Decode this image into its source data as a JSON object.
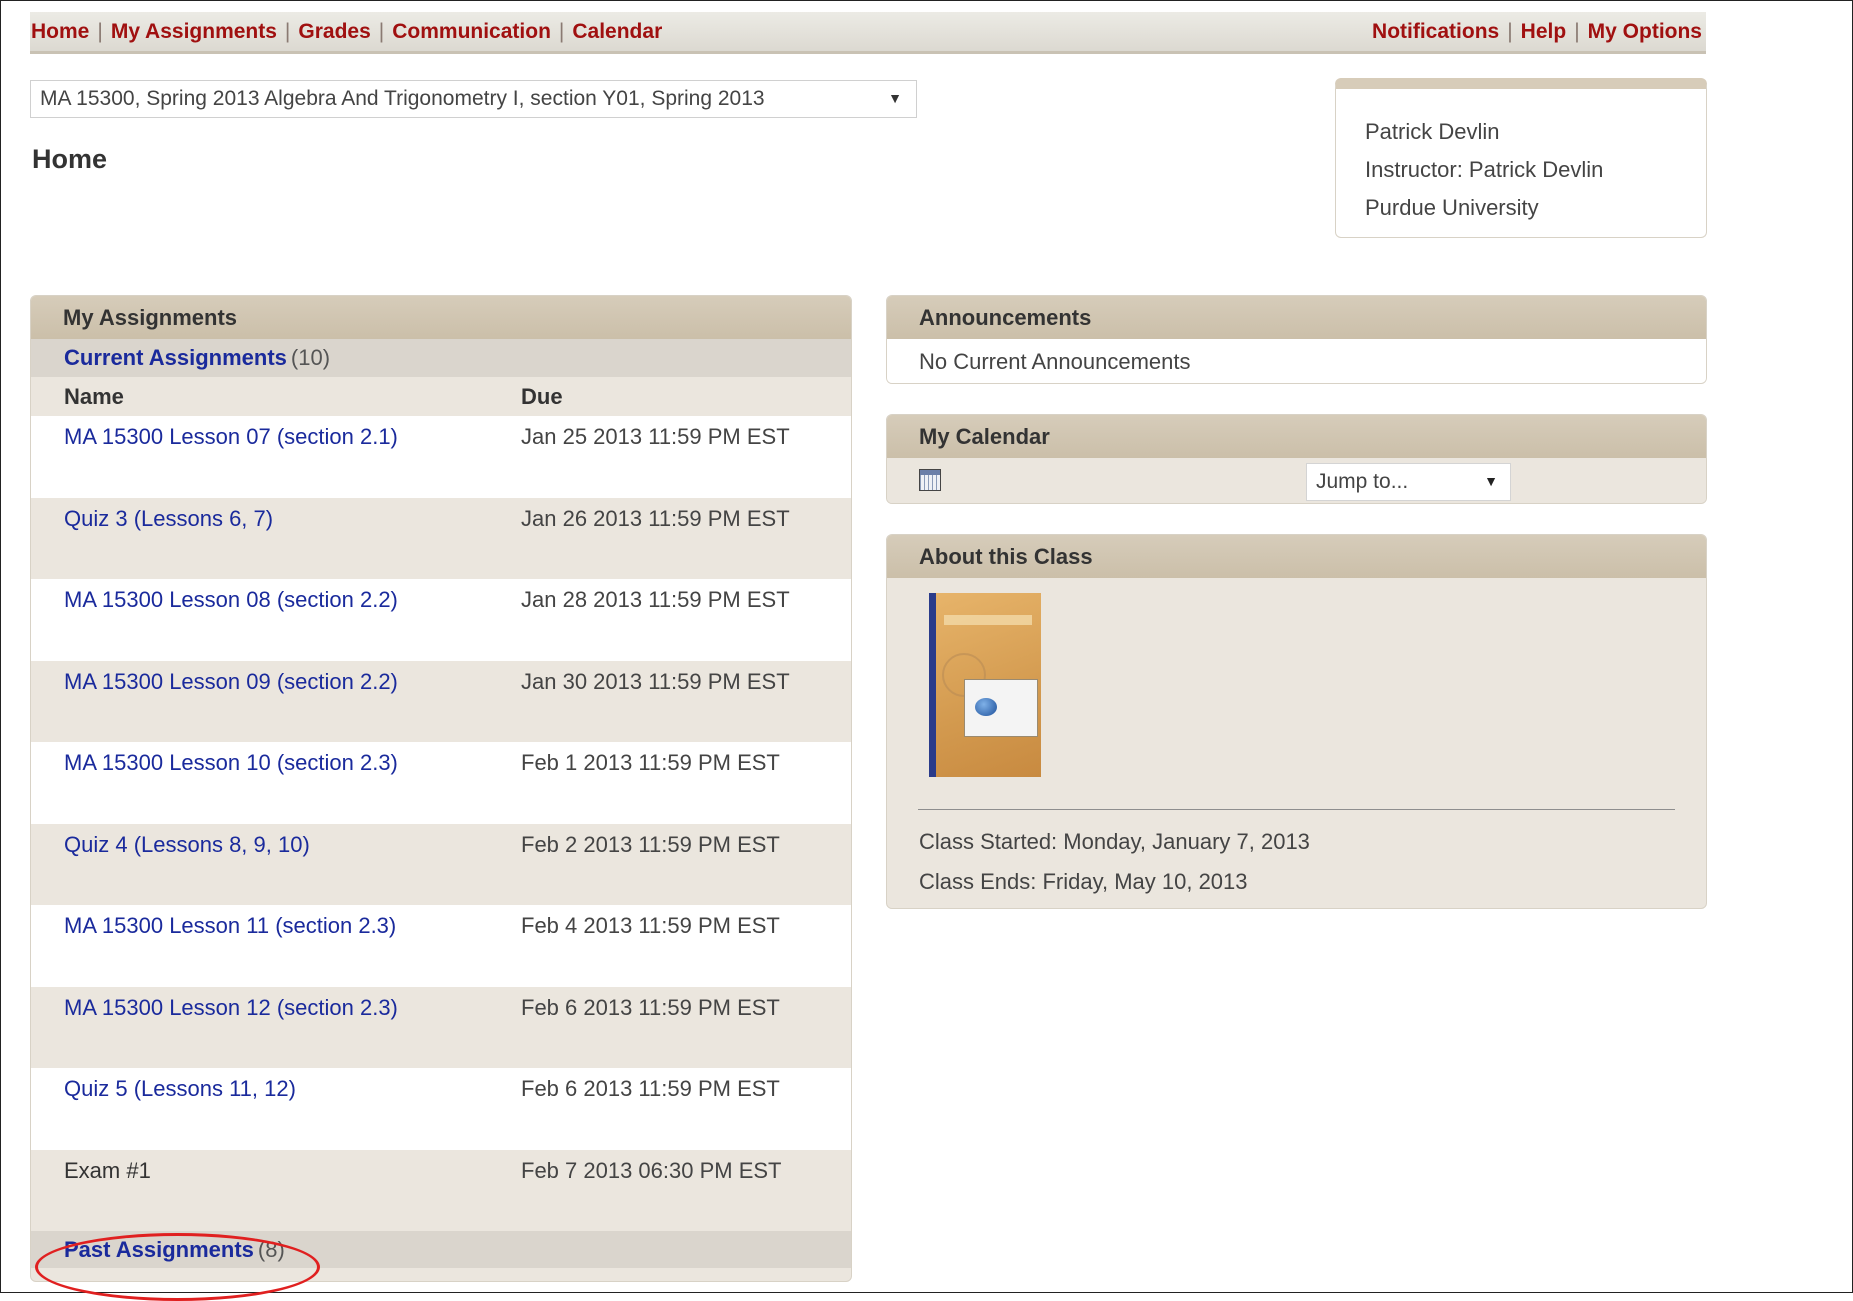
{
  "nav": {
    "left": [
      "Home",
      "My Assignments",
      "Grades",
      "Communication",
      "Calendar"
    ],
    "right": [
      "Notifications",
      "Help",
      "My Options"
    ]
  },
  "course_selector": {
    "value": "MA 15300, Spring 2013 Algebra And Trigonometry I, section Y01, Spring 2013"
  },
  "page_title": "Home",
  "user_box": {
    "name": "Patrick Devlin",
    "instructor": "Instructor: Patrick Devlin",
    "school": "Purdue University"
  },
  "assignments": {
    "title": "My Assignments",
    "current_label": "Current Assignments",
    "current_count": "(10)",
    "col_name": "Name",
    "col_due": "Due",
    "rows": [
      {
        "name": "MA 15300 Lesson 07 (section 2.1)",
        "due": "Jan 25 2013 11:59 PM EST"
      },
      {
        "name": "Quiz 3 (Lessons 6, 7)",
        "due": "Jan 26 2013 11:59 PM EST"
      },
      {
        "name": "MA 15300 Lesson 08 (section 2.2)",
        "due": "Jan 28 2013 11:59 PM EST"
      },
      {
        "name": "MA 15300 Lesson 09 (section 2.2)",
        "due": "Jan 30 2013 11:59 PM EST"
      },
      {
        "name": "MA 15300 Lesson 10 (section 2.3)",
        "due": "Feb 1 2013 11:59 PM EST"
      },
      {
        "name": "Quiz 4 (Lessons 8, 9, 10)",
        "due": "Feb 2 2013 11:59 PM EST"
      },
      {
        "name": "MA 15300 Lesson 11 (section 2.3)",
        "due": "Feb 4 2013 11:59 PM EST"
      },
      {
        "name": "MA 15300 Lesson 12 (section 2.3)",
        "due": "Feb 6 2013 11:59 PM EST"
      },
      {
        "name": "Quiz 5 (Lessons 11, 12)",
        "due": "Feb 6 2013 11:59 PM EST"
      },
      {
        "name": "Exam #1",
        "due": "Feb 7 2013 06:30 PM EST"
      }
    ],
    "past_label": "Past Assignments",
    "past_count": "(8)"
  },
  "announcements": {
    "title": "Announcements",
    "body": "No Current Announcements"
  },
  "calendar": {
    "title": "My Calendar",
    "jump_label": "Jump to...",
    "icon": "calendar-icon"
  },
  "about": {
    "title": "About this Class",
    "started": "Class Started: Monday, January 7, 2013",
    "ends": "Class Ends: Friday, May 10, 2013"
  },
  "colors": {
    "nav_link": "#a01010",
    "link": "#1a2a9c",
    "panel_header": "#d0c5b1",
    "highlight": "#e02020"
  }
}
